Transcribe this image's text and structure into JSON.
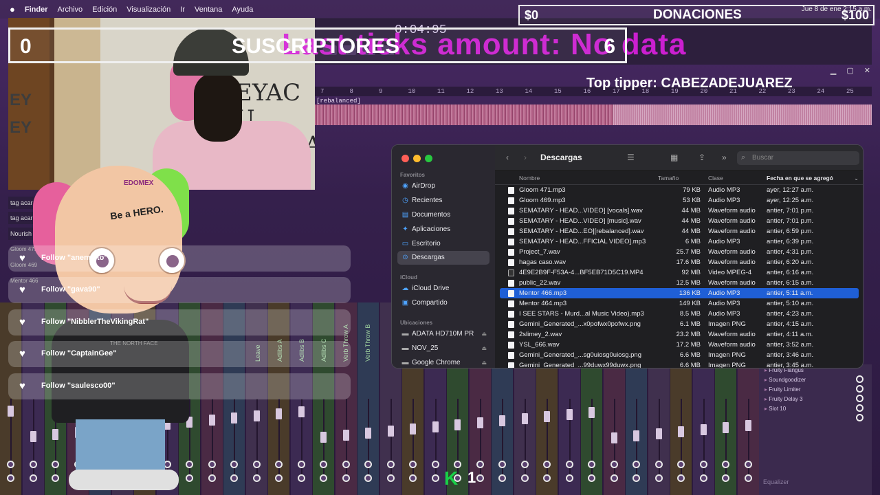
{
  "menubar": {
    "app": "Finder",
    "items": [
      "Archivo",
      "Edición",
      "Visualización",
      "Ir",
      "Ventana",
      "Ayuda"
    ],
    "clock": "Jue 8 de ene  2:15 a.m."
  },
  "daw": {
    "time": "0:04:95",
    "clip_label": "[rebalanced]",
    "ruler": [
      "7",
      "8",
      "9",
      "10",
      "11",
      "12",
      "13",
      "14",
      "15",
      "16",
      "17",
      "18",
      "19",
      "20",
      "21",
      "22",
      "23",
      "24",
      "25"
    ],
    "mixer_names": [
      "Leave",
      "Adlibs A",
      "Adlibs B",
      "Adlibs C",
      "Verb Throw A",
      "Verb Throw B"
    ],
    "plugins": [
      "Fruity Flangus",
      "Soundgoodizer",
      "Fruity Limiter",
      "Fruity Delay 3",
      "Slot 10"
    ],
    "equalizer_label": "Equalizer"
  },
  "overlay": {
    "subs_count": "0",
    "subs_label": "SUSCRIPTORES",
    "subs_goal": "6",
    "ticks_banner": "Last ticks amount: No data",
    "donations_current": "$0",
    "donations_label": "DONACIONES",
    "donations_goal": "$100",
    "top_tipper": "Top tipper: CABEZADEJUAREZ",
    "left_tabs": [
      "tag acar",
      "tag acar",
      "Nourish"
    ],
    "left_small": [
      "Gloom 471",
      "Gloom 469",
      "Mentor 466"
    ]
  },
  "avatar": {
    "logo": "EDOMEX",
    "hero": "Be a HERO."
  },
  "follows": [
    "Follow \"anemsito\"",
    "Follow \"gava90\"",
    "Follow \"NibblerTheVikingRat\"",
    "Follow \"CaptainGee\"",
    "Follow \"saulesco00\""
  ],
  "finder": {
    "title": "Descargas",
    "search_placeholder": "Buscar",
    "sections": {
      "favorites": "Favoritos",
      "icloud": "iCloud",
      "locations": "Ubicaciones"
    },
    "favorites": [
      "AirDrop",
      "Recientes",
      "Documentos",
      "Aplicaciones",
      "Escritorio",
      "Descargas"
    ],
    "icloud": [
      "iCloud Drive",
      "Compartido"
    ],
    "locations": [
      "ADATA HD710M PR",
      "NOV_25",
      "Google Chrome"
    ],
    "columns": {
      "name": "Nombre",
      "size": "Tamaño",
      "kind": "Clase",
      "date": "Fecha en que se agregó"
    },
    "files": [
      {
        "name": "Gloom 471.mp3",
        "size": "79 KB",
        "kind": "Audio MP3",
        "date": "ayer, 12:27 a.m."
      },
      {
        "name": "Gloom 469.mp3",
        "size": "53 KB",
        "kind": "Audio MP3",
        "date": "ayer, 12:25 a.m."
      },
      {
        "name": "SEMATARY - HEAD...VIDEO] [vocals].wav",
        "size": "44 MB",
        "kind": "Waveform audio",
        "date": "antier, 7:01 p.m."
      },
      {
        "name": "SEMATARY - HEAD...VIDEO] [music].wav",
        "size": "44 MB",
        "kind": "Waveform audio",
        "date": "antier, 7:01 p.m."
      },
      {
        "name": "SEMATARY - HEAD...EO][rebalanced].wav",
        "size": "44 MB",
        "kind": "Waveform audio",
        "date": "antier, 6:59 p.m."
      },
      {
        "name": "SEMATARY - HEAD...FFICIAL VIDEO].mp3",
        "size": "6 MB",
        "kind": "Audio MP3",
        "date": "antier, 6:39 p.m."
      },
      {
        "name": "Project_7.wav",
        "size": "25.7 MB",
        "kind": "Waveform audio",
        "date": "antier, 4:31 p.m."
      },
      {
        "name": "hagas caso.wav",
        "size": "17.6 MB",
        "kind": "Waveform audio",
        "date": "antier, 6:20 a.m."
      },
      {
        "name": "4E9E2B9F-F53A-4...BF5EB71D5C19.MP4",
        "size": "92 MB",
        "kind": "Video MPEG-4",
        "date": "antier, 6:16 a.m."
      },
      {
        "name": "public_22.wav",
        "size": "12.5 MB",
        "kind": "Waveform audio",
        "date": "antier, 6:15 a.m."
      },
      {
        "name": "Mentor 466.mp3",
        "size": "136 KB",
        "kind": "Audio MP3",
        "date": "antier, 5:11 a.m."
      },
      {
        "name": "Mentor 464.mp3",
        "size": "149 KB",
        "kind": "Audio MP3",
        "date": "antier, 5:10 a.m."
      },
      {
        "name": "I SEE STARS - Murd...al Music Video).mp3",
        "size": "8.5 MB",
        "kind": "Audio MP3",
        "date": "antier, 4:23 a.m."
      },
      {
        "name": "Gemini_Generated_...x0pofwx0pofwx.png",
        "size": "6.1 MB",
        "kind": "Imagen PNG",
        "date": "antier, 4:15 a.m."
      },
      {
        "name": "2slimey_2.wav",
        "size": "23.2 MB",
        "kind": "Waveform audio",
        "date": "antier, 4:11 a.m."
      },
      {
        "name": "YSL_666.wav",
        "size": "17.2 MB",
        "kind": "Waveform audio",
        "date": "antier, 3:52 a.m."
      },
      {
        "name": "Gemini_Generated_...sg0uiosg0uiosg.png",
        "size": "6.6 MB",
        "kind": "Imagen PNG",
        "date": "antier, 3:46 a.m."
      },
      {
        "name": "Gemini_Generated_...99duwx99duwx.png",
        "size": "6.6 MB",
        "kind": "Imagen PNG",
        "date": "antier, 3:45 a.m."
      }
    ],
    "selected_file": "Mentor 466.mp3"
  },
  "bottom_badge": {
    "letter": "K",
    "number": "1"
  },
  "colors": {
    "selection": "#1f5fd6",
    "banner": "#d420d8",
    "k_badge": "#18d148"
  }
}
